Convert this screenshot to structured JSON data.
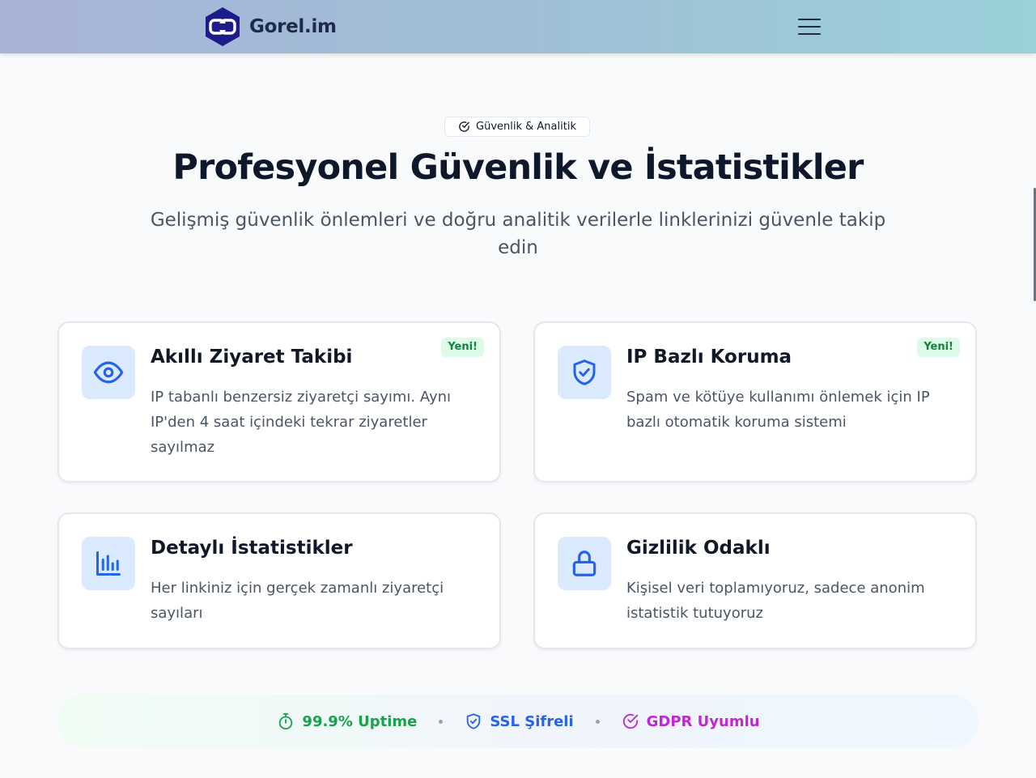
{
  "header": {
    "brand": "Gorel.im",
    "menu_icon": "hamburger-icon"
  },
  "hero": {
    "badge": "Güvenlik & Analitik",
    "title": "Profesyonel Güvenlik ve İstatistikler",
    "subtitle": "Gelişmiş güvenlik önlemleri ve doğru analitik verilerle linklerinizi güvenle takip edin"
  },
  "features": [
    {
      "icon": "eye-icon",
      "title": "Akıllı Ziyaret Takibi",
      "description": "IP tabanlı benzersiz ziyaretçi sayımı. Aynı IP'den 4 saat içindeki tekrar ziyaretler sayılmaz",
      "badge": "Yeni!"
    },
    {
      "icon": "shield-check-icon",
      "title": "IP Bazlı Koruma",
      "description": "Spam ve kötüye kullanımı önlemek için IP bazlı otomatik koruma sistemi",
      "badge": "Yeni!"
    },
    {
      "icon": "bar-chart-icon",
      "title": "Detaylı İstatistikler",
      "description": "Her linkiniz için gerçek zamanlı ziyaretçi sayıları"
    },
    {
      "icon": "lock-icon",
      "title": "Gizlilik Odaklı",
      "description": "Kişisel veri toplamıyoruz, sadece anonim istatistik tutuyoruz"
    }
  ],
  "stats": [
    {
      "icon": "stopwatch-icon",
      "label": "99.9% Uptime",
      "color": "#16a34a"
    },
    {
      "icon": "shield-icon",
      "label": "SSL Şifreli",
      "color": "#2563eb"
    },
    {
      "icon": "check-circle-icon",
      "label": "GDPR Uyumlu",
      "color": "#c026d3"
    }
  ],
  "colors": {
    "accent": "#2563eb",
    "icon_bg": "#dbeafe",
    "new_badge_bg": "#dcfce7",
    "new_badge_text": "#15803d"
  }
}
